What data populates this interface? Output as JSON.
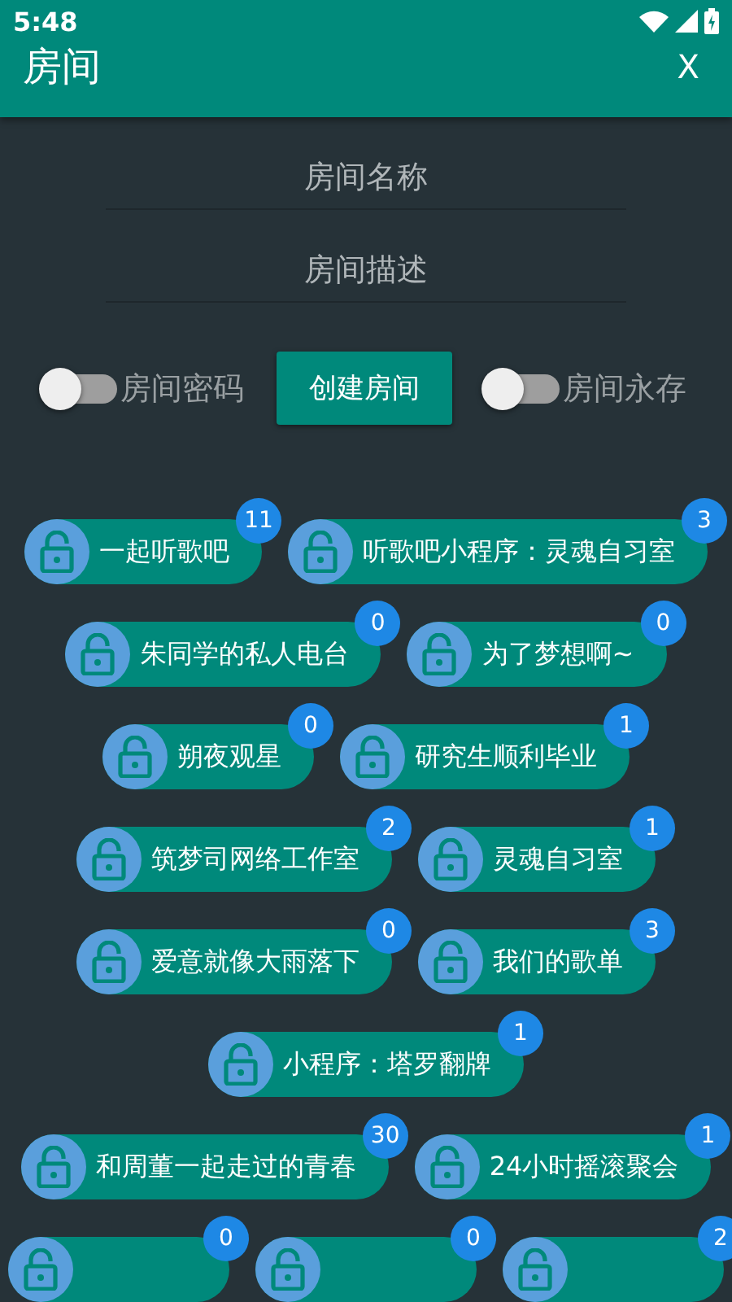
{
  "status_bar": {
    "time": "5:48"
  },
  "header": {
    "title": "房间",
    "close": "X"
  },
  "fields": [
    {
      "placeholder": "房间名称"
    },
    {
      "placeholder": "房间描述"
    }
  ],
  "options": {
    "password": {
      "label": "房间密码",
      "on": false
    },
    "create_button": "创建房间",
    "permanent": {
      "label": "房间永存",
      "on": false
    }
  },
  "room_rows": [
    {
      "rooms": [
        {
          "name": "一起听歌吧",
          "count": "11"
        },
        {
          "name": "听歌吧小程序：灵魂自习室",
          "count": "3"
        }
      ]
    },
    {
      "rooms": [
        {
          "name": "朱同学的私人电台",
          "count": "0"
        },
        {
          "name": "为了梦想啊~",
          "count": "0"
        }
      ]
    },
    {
      "rooms": [
        {
          "name": "朔夜观星",
          "count": "0"
        },
        {
          "name": "研究生顺利毕业",
          "count": "1"
        }
      ]
    },
    {
      "rooms": [
        {
          "name": "筑梦司网络工作室",
          "count": "2"
        },
        {
          "name": "灵魂自习室",
          "count": "1"
        }
      ]
    },
    {
      "rooms": [
        {
          "name": "爱意就像大雨落下",
          "count": "0"
        },
        {
          "name": "我们的歌单",
          "count": "3"
        }
      ]
    },
    {
      "rooms": [
        {
          "name": "小程序：塔罗翻牌",
          "count": "1"
        }
      ]
    },
    {
      "rooms": [
        {
          "name": "和周董一起走过的青春",
          "count": "30"
        },
        {
          "name": "24小时摇滚聚会",
          "count": "1"
        }
      ]
    },
    {
      "rooms": [
        {
          "count": "0"
        },
        {
          "count": "0"
        },
        {
          "count": "2"
        }
      ]
    }
  ]
}
